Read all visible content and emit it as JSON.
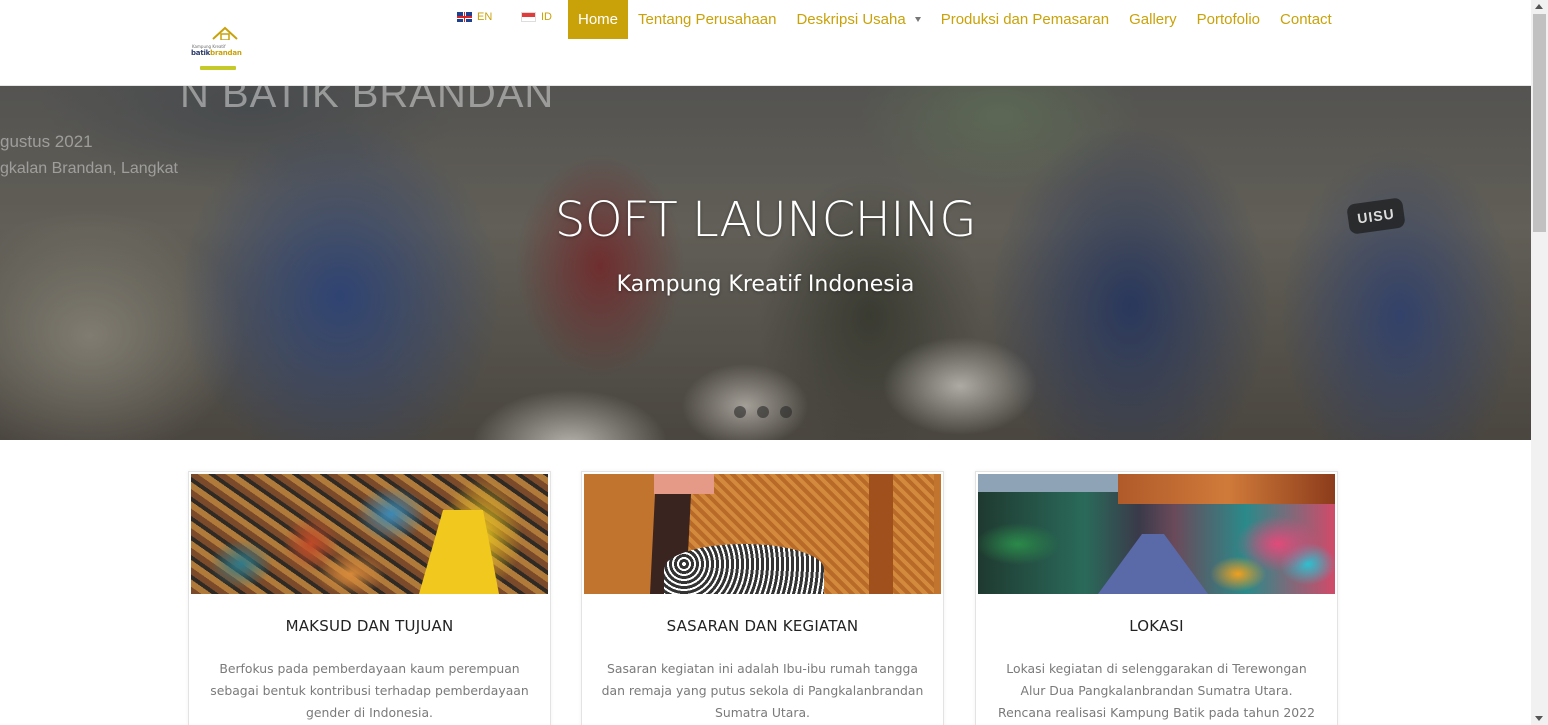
{
  "header": {
    "logo": {
      "small_text": "Kampung Kreatif",
      "brand_main": "batik",
      "brand_accent": "brandan"
    },
    "languages": [
      {
        "code": "EN",
        "flag": "flag-uk-icon"
      },
      {
        "code": "ID",
        "flag": "flag-id-icon"
      }
    ],
    "nav": [
      {
        "label": "Home",
        "active": true
      },
      {
        "label": "Tentang Perusahaan"
      },
      {
        "label": "Deskripsi Usaha",
        "dropdown": true
      },
      {
        "label": "Produksi dan Pemasaran"
      },
      {
        "label": "Gallery"
      },
      {
        "label": "Portofolio"
      },
      {
        "label": "Contact"
      }
    ],
    "accent_color": "#c9a20a"
  },
  "hero": {
    "title": "SOFT LAUNCHING",
    "subtitle": "Kampung Kreatif Indonesia",
    "background_text": [
      "N BATIK BRANDAN",
      "gustus 2021",
      "gkalan Brandan, Langkat"
    ],
    "badge_text": "UISU",
    "slides_count": 3
  },
  "cards": [
    {
      "title": "MAKSUD DAN TUJUAN",
      "text": "Berfokus pada pemberdayaan kaum perempuan sebagai bentuk kontribusi terhadap pemberdayaan gender di Indonesia."
    },
    {
      "title": "SASARAN DAN KEGIATAN",
      "text": "Sasaran kegiatan ini adalah Ibu-ibu rumah tangga dan remaja yang putus sekola di Pangkalanbrandan Sumatra Utara."
    },
    {
      "title": "LOKASI",
      "text": "Lokasi kegiatan di selenggarakan di Terewongan Alur Dua Pangkalanbrandan Sumatra Utara. Rencana realisasi Kampung Batik pada tahun 2022"
    }
  ]
}
